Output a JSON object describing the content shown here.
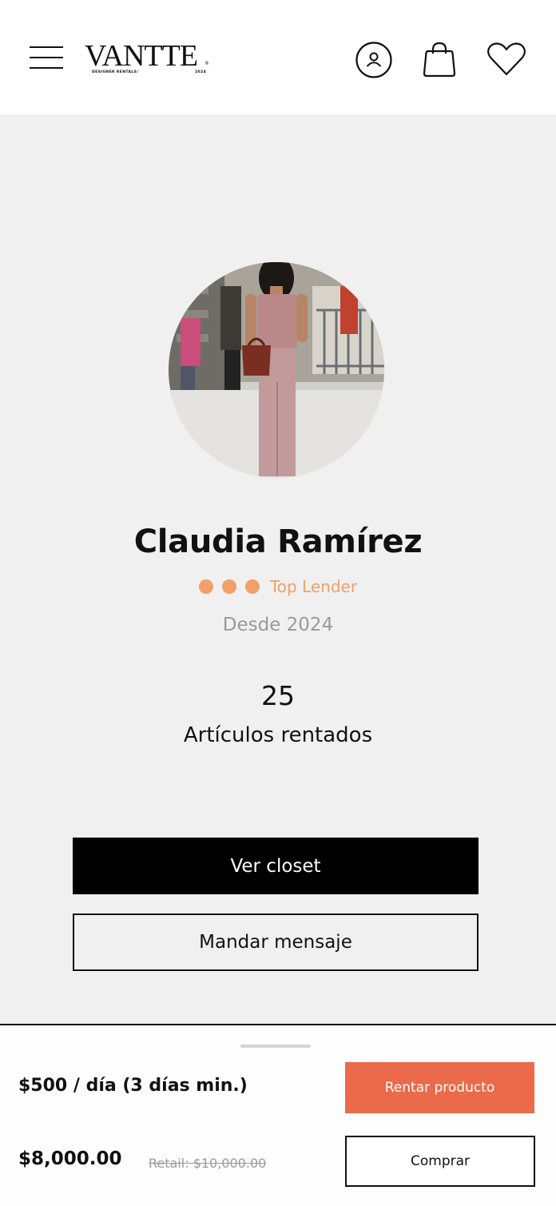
{
  "header": {
    "logo_text": "VANTTE",
    "logo_registered": "®",
    "logo_subtitle": "DESIGNER RENTALS/",
    "logo_year": "2024",
    "icons": [
      "menu-icon",
      "account-icon",
      "bag-icon",
      "heart-icon"
    ]
  },
  "profile": {
    "name": "Claudia Ramírez",
    "badge_dots": 3,
    "badge_label": "Top Lender",
    "since": "Desde 2024",
    "rented_count": "25",
    "rented_label": "Artículos rentados",
    "view_closet_label": "Ver closet",
    "message_label": "Mandar mensaje"
  },
  "sheet": {
    "price_per_day": "$500 / día (3 días min.)",
    "price": "$8,000.00",
    "retail": "Retail: $10,000.00",
    "rent_label": "Rentar producto",
    "buy_label": "Comprar"
  },
  "colors": {
    "accent": "#ea6a4a",
    "badge": "#f0a068",
    "background": "#f0f0f0",
    "muted_text": "#9a9a9a"
  }
}
